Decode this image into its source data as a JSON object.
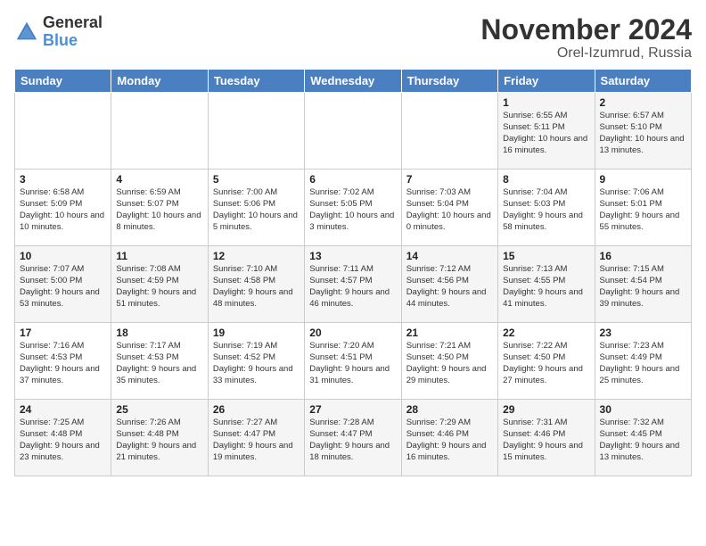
{
  "header": {
    "logo": {
      "general": "General",
      "blue": "Blue"
    },
    "title": "November 2024",
    "location": "Orel-Izumrud, Russia"
  },
  "weekdays": [
    "Sunday",
    "Monday",
    "Tuesday",
    "Wednesday",
    "Thursday",
    "Friday",
    "Saturday"
  ],
  "weeks": [
    [
      {
        "day": "",
        "info": ""
      },
      {
        "day": "",
        "info": ""
      },
      {
        "day": "",
        "info": ""
      },
      {
        "day": "",
        "info": ""
      },
      {
        "day": "",
        "info": ""
      },
      {
        "day": "1",
        "info": "Sunrise: 6:55 AM\nSunset: 5:11 PM\nDaylight: 10 hours and 16 minutes."
      },
      {
        "day": "2",
        "info": "Sunrise: 6:57 AM\nSunset: 5:10 PM\nDaylight: 10 hours and 13 minutes."
      }
    ],
    [
      {
        "day": "3",
        "info": "Sunrise: 6:58 AM\nSunset: 5:09 PM\nDaylight: 10 hours and 10 minutes."
      },
      {
        "day": "4",
        "info": "Sunrise: 6:59 AM\nSunset: 5:07 PM\nDaylight: 10 hours and 8 minutes."
      },
      {
        "day": "5",
        "info": "Sunrise: 7:00 AM\nSunset: 5:06 PM\nDaylight: 10 hours and 5 minutes."
      },
      {
        "day": "6",
        "info": "Sunrise: 7:02 AM\nSunset: 5:05 PM\nDaylight: 10 hours and 3 minutes."
      },
      {
        "day": "7",
        "info": "Sunrise: 7:03 AM\nSunset: 5:04 PM\nDaylight: 10 hours and 0 minutes."
      },
      {
        "day": "8",
        "info": "Sunrise: 7:04 AM\nSunset: 5:03 PM\nDaylight: 9 hours and 58 minutes."
      },
      {
        "day": "9",
        "info": "Sunrise: 7:06 AM\nSunset: 5:01 PM\nDaylight: 9 hours and 55 minutes."
      }
    ],
    [
      {
        "day": "10",
        "info": "Sunrise: 7:07 AM\nSunset: 5:00 PM\nDaylight: 9 hours and 53 minutes."
      },
      {
        "day": "11",
        "info": "Sunrise: 7:08 AM\nSunset: 4:59 PM\nDaylight: 9 hours and 51 minutes."
      },
      {
        "day": "12",
        "info": "Sunrise: 7:10 AM\nSunset: 4:58 PM\nDaylight: 9 hours and 48 minutes."
      },
      {
        "day": "13",
        "info": "Sunrise: 7:11 AM\nSunset: 4:57 PM\nDaylight: 9 hours and 46 minutes."
      },
      {
        "day": "14",
        "info": "Sunrise: 7:12 AM\nSunset: 4:56 PM\nDaylight: 9 hours and 44 minutes."
      },
      {
        "day": "15",
        "info": "Sunrise: 7:13 AM\nSunset: 4:55 PM\nDaylight: 9 hours and 41 minutes."
      },
      {
        "day": "16",
        "info": "Sunrise: 7:15 AM\nSunset: 4:54 PM\nDaylight: 9 hours and 39 minutes."
      }
    ],
    [
      {
        "day": "17",
        "info": "Sunrise: 7:16 AM\nSunset: 4:53 PM\nDaylight: 9 hours and 37 minutes."
      },
      {
        "day": "18",
        "info": "Sunrise: 7:17 AM\nSunset: 4:53 PM\nDaylight: 9 hours and 35 minutes."
      },
      {
        "day": "19",
        "info": "Sunrise: 7:19 AM\nSunset: 4:52 PM\nDaylight: 9 hours and 33 minutes."
      },
      {
        "day": "20",
        "info": "Sunrise: 7:20 AM\nSunset: 4:51 PM\nDaylight: 9 hours and 31 minutes."
      },
      {
        "day": "21",
        "info": "Sunrise: 7:21 AM\nSunset: 4:50 PM\nDaylight: 9 hours and 29 minutes."
      },
      {
        "day": "22",
        "info": "Sunrise: 7:22 AM\nSunset: 4:50 PM\nDaylight: 9 hours and 27 minutes."
      },
      {
        "day": "23",
        "info": "Sunrise: 7:23 AM\nSunset: 4:49 PM\nDaylight: 9 hours and 25 minutes."
      }
    ],
    [
      {
        "day": "24",
        "info": "Sunrise: 7:25 AM\nSunset: 4:48 PM\nDaylight: 9 hours and 23 minutes."
      },
      {
        "day": "25",
        "info": "Sunrise: 7:26 AM\nSunset: 4:48 PM\nDaylight: 9 hours and 21 minutes."
      },
      {
        "day": "26",
        "info": "Sunrise: 7:27 AM\nSunset: 4:47 PM\nDaylight: 9 hours and 19 minutes."
      },
      {
        "day": "27",
        "info": "Sunrise: 7:28 AM\nSunset: 4:47 PM\nDaylight: 9 hours and 18 minutes."
      },
      {
        "day": "28",
        "info": "Sunrise: 7:29 AM\nSunset: 4:46 PM\nDaylight: 9 hours and 16 minutes."
      },
      {
        "day": "29",
        "info": "Sunrise: 7:31 AM\nSunset: 4:46 PM\nDaylight: 9 hours and 15 minutes."
      },
      {
        "day": "30",
        "info": "Sunrise: 7:32 AM\nSunset: 4:45 PM\nDaylight: 9 hours and 13 minutes."
      }
    ]
  ]
}
